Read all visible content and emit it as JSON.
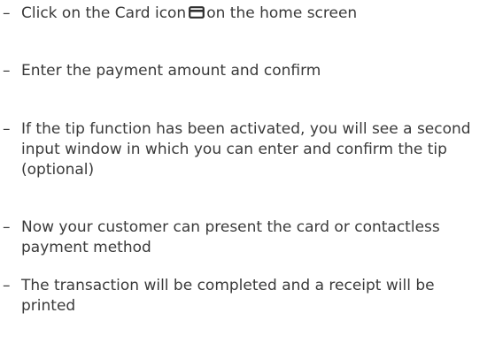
{
  "steps": [
    {
      "dash": "–",
      "before_icon": "Click on the Card icon",
      "icon": "card-icon",
      "after_icon": "on the home screen"
    },
    {
      "dash": "–",
      "text": "Enter the payment amount and confirm"
    },
    {
      "dash": "–",
      "text": "If the tip function has been activated, you will see a second input window in which you can enter and confirm the tip (optional)"
    },
    {
      "dash": "–",
      "text": "Now your customer can present the card or contactless payment method"
    },
    {
      "dash": "–",
      "text": "The transaction will be completed and a receipt will be printed"
    }
  ],
  "colors": {
    "text": "#3a3a3a"
  }
}
